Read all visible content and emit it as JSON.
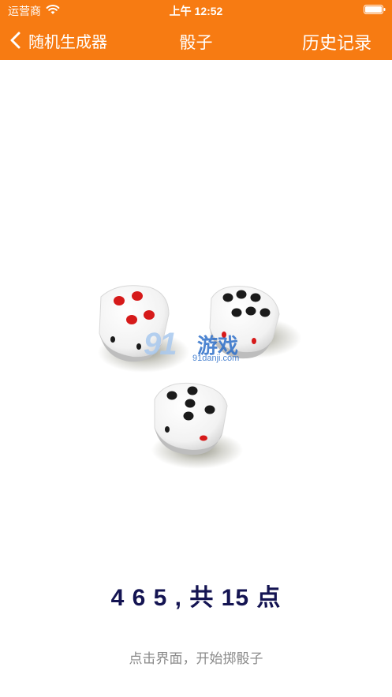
{
  "status_bar": {
    "carrier": "运营商",
    "time": "上午 12:52"
  },
  "nav": {
    "back_label": "随机生成器",
    "title": "骰子",
    "history_label": "历史记录"
  },
  "dice": {
    "values": [
      4,
      6,
      5
    ],
    "pip_color_normal": "#1a1a1a",
    "pip_color_red": "#d61a1a"
  },
  "watermark": {
    "logo_number": "91",
    "logo_text": "游戏",
    "domain": "91danji.com"
  },
  "result": {
    "text": "4 6 5 , 共 15 点"
  },
  "hint": {
    "text": "点击界面，开始掷骰子"
  },
  "colors": {
    "accent": "#f77b12",
    "result_text": "#141452",
    "hint_text": "#8a8a8a"
  }
}
